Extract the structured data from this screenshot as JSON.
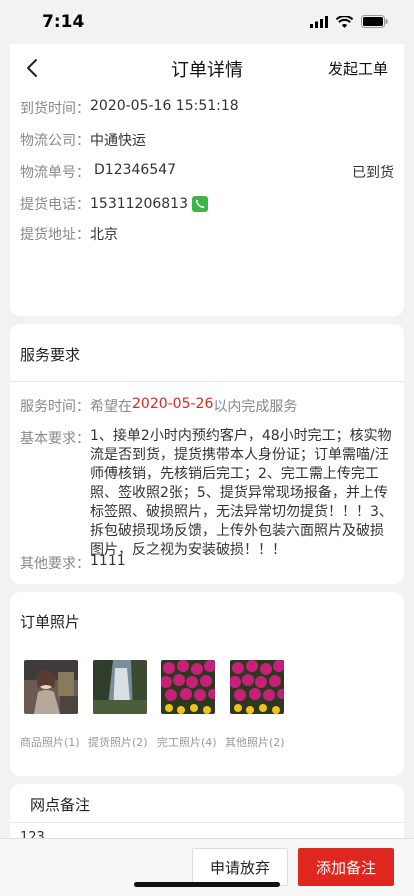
{
  "status": {
    "time": "7:14"
  },
  "nav": {
    "title": "订单详情",
    "action": "发起工单"
  },
  "logistics": {
    "arrival_label": "到货时间：",
    "arrival_value": "2020-05-16 15:51:18",
    "company_label": "物流公司：",
    "company_value": "中通快运",
    "tracking_label": "物流单号：",
    "tracking_value": "D12346547",
    "tracking_status": "已到货",
    "phone_label": "提货电话：",
    "phone_value": "15311206813",
    "address_label": "提货地址：",
    "address_value": "北京"
  },
  "service": {
    "title": "服务要求",
    "time_label": "服务时间：",
    "time_prefix": "希望在",
    "time_date": "2020-05-26",
    "time_suffix": "以内完成服务",
    "basic_label": "基本要求：",
    "basic_value": "1、接单2小时内预约客户，48小时完工；核实物流是否到货，提货携带本人身份证；订单需喵/汪师傅核销，先核销后完工；2、完工需上传完工照、签收照2张；5、提货异常现场报备，并上传标签照、破损照片，无法异常切勿提货！！！3、拆包破损现场反馈，上传外包装六面照片及破损图片，反之视为安装破损！！！",
    "other_label": "其他要求：",
    "other_value": "1111"
  },
  "photos": {
    "title": "订单照片",
    "labels": [
      "商品照片(1)",
      "提货照片(2)",
      "完工照片(4)",
      "其他照片(2)"
    ]
  },
  "notes": {
    "title": "网点备注",
    "partial_text": "123"
  },
  "bottom": {
    "giveup_label": "申请放弃",
    "add_label": "添加备注"
  },
  "colors": {
    "accent": "#e0271f",
    "background": "#f2f2f2"
  }
}
